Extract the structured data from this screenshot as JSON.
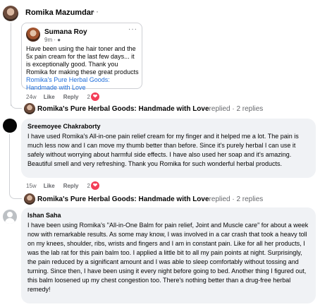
{
  "top_post": {
    "author": "Romika Mazumdar",
    "more": "···",
    "shared_comment": {
      "author": "Sumana Roy",
      "time": "9m",
      "more": "···",
      "text": "Have been using the hair toner and the 5x pain cream for the last few days... it is exceptionally good. Thank you Romika for making these great products ",
      "link_text": "Romika's Pure Herbal Goods: Handmade with Love"
    },
    "actions": {
      "time": "24w",
      "like": "Like",
      "reply": "Reply",
      "reaction_count": "2"
    },
    "replies_summary": {
      "page_name": "Romika's Pure Herbal Goods: Handmade with Love",
      "suffix": " replied · 2 replies"
    }
  },
  "comments": [
    {
      "author": "Sreemoyee Chakraborty",
      "text": "I have used Romika's All-in-one pain relief cream for my finger and it helped me a lot. The pain is much less now and I can move my thumb better than before. Since it's purely herbal I can use it safely without worrying about harmful side effects. I have also used her soap and it's amazing. Beautiful smell and very refreshing. Thank you Romika for such wonderful herbal products.",
      "actions": {
        "time": "15w",
        "like": "Like",
        "reply": "Reply",
        "reaction_count": "2"
      },
      "replies_summary": {
        "page_name": "Romika's Pure Herbal Goods: Handmade with Love",
        "suffix": " replied · 2 replies"
      }
    },
    {
      "author": "Ishan Saha",
      "text": "I have been using Romika's \"All-in-One Balm for pain relief, Joint and Muscle care\" for about a week now with remarkable results. As some may know, I was involved in a car crash that took a heavy toll on my knees, shoulder, ribs, wrists and fingers and I am in constant pain. Like for all her products, I was the lab rat for this pain balm too. I applied a little bit to all my pain points at night. Surprisingly, the pain reduced by a significant amount and I was able to sleep comfortably without tossing and turning. Since then, I have been using it every night before going to bed. Another thing I figured out, this balm loosened up my chest congestion too. There's nothing better than a drug-free herbal remedy!"
    }
  ],
  "colors": {
    "link": "#216fdb",
    "bubble": "#f0f2f5",
    "reaction": "#f33e58",
    "muted": "#65676b"
  },
  "icons": {
    "reaction": "heart-icon"
  }
}
